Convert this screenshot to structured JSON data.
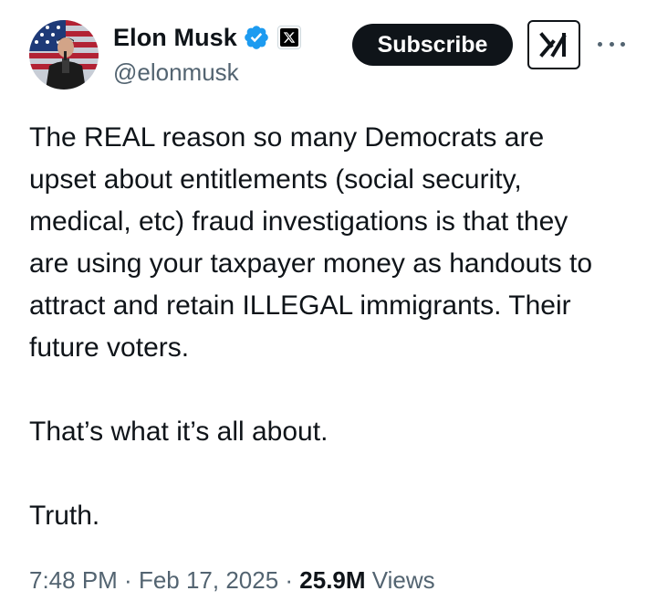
{
  "author": {
    "name": "Elon Musk",
    "handle": "@elonmusk",
    "verified_icon": "verified-badge-icon",
    "affiliate_icon": "x-logo-icon",
    "brand_color": "#1d9bf0"
  },
  "header": {
    "subscribe_label": "Subscribe",
    "grok_icon": "grok-icon",
    "more_icon": "more-options-icon"
  },
  "tweet": {
    "text": "The REAL reason so many Democrats are upset about entitlements (social security, medical, etc) fraud investigations is that they are using your taxpayer money as handouts to attract and retain ILLEGAL immigrants. Their future voters.\n\nThat’s what it’s all about.\n\nTruth."
  },
  "meta": {
    "time": "7:48 PM",
    "separator": " · ",
    "date": "Feb 17, 2025",
    "views_count": "25.9M",
    "views_label": " Views"
  }
}
